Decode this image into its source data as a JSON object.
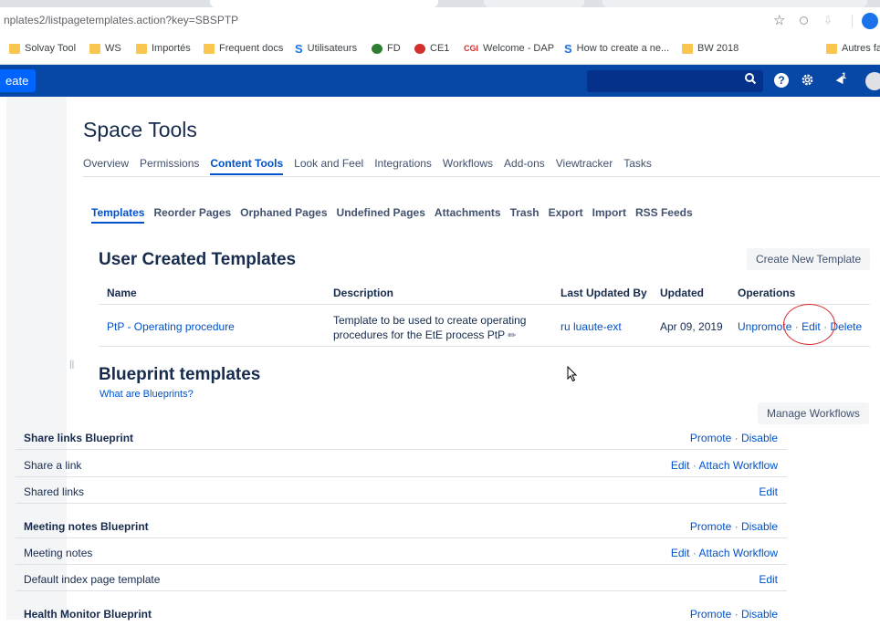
{
  "browser": {
    "url": "nplates2/listpagetemplates.action?key=SBSPTP",
    "bookmarks": [
      {
        "label": "Solvay Tool",
        "icon": "folder-icon"
      },
      {
        "label": "WS",
        "icon": "folder-icon"
      },
      {
        "label": "Importés",
        "icon": "folder-icon"
      },
      {
        "label": "Frequent docs",
        "icon": "folder-icon"
      },
      {
        "label": "Utilisateurs",
        "icon": "solvay-icon"
      },
      {
        "label": "FD",
        "icon": "green-circle-icon"
      },
      {
        "label": "CE1",
        "icon": "red-circle-icon"
      },
      {
        "label": "Welcome - DAP",
        "icon": "cgi-icon"
      },
      {
        "label": "How to create a ne...",
        "icon": "solvay-icon"
      },
      {
        "label": "BW 2018",
        "icon": "folder-icon"
      },
      {
        "label": "Autres fa",
        "icon": "folder-icon"
      }
    ]
  },
  "header": {
    "create_label": "eate",
    "notification_count": "1"
  },
  "page": {
    "title": "Space Tools",
    "tabs": [
      "Overview",
      "Permissions",
      "Content Tools",
      "Look and Feel",
      "Integrations",
      "Workflows",
      "Add-ons",
      "Viewtracker",
      "Tasks"
    ],
    "active_tab": "Content Tools",
    "subtabs": [
      "Templates",
      "Reorder Pages",
      "Orphaned Pages",
      "Undefined Pages",
      "Attachments",
      "Trash",
      "Export",
      "Import",
      "RSS Feeds"
    ],
    "active_subtab": "Templates"
  },
  "user_templates": {
    "heading": "User Created Templates",
    "create_button": "Create New Template",
    "columns": {
      "name": "Name",
      "description": "Description",
      "last_updated_by": "Last Updated By",
      "updated": "Updated",
      "operations": "Operations"
    },
    "rows": [
      {
        "name": "PtP - Operating procedure",
        "description_line1": "Template to be used to create operating",
        "description_line2": "procedures for the EtE process PtP",
        "last_updated_by": "ru luaute-ext",
        "updated": "Apr 09, 2019",
        "op_unpromote": "Unpromote",
        "op_edit": "Edit",
        "op_delete": "Delete",
        "separator": "·"
      }
    ]
  },
  "blueprints": {
    "heading": "Blueprint templates",
    "help_link": "What are Blueprints?",
    "manage_button": "Manage Workflows",
    "rows": [
      {
        "name": "Share links Blueprint",
        "bold": true,
        "a1": "Promote",
        "a2": "Disable"
      },
      {
        "name": "Share a link",
        "bold": false,
        "a1": "Edit",
        "a2": "Attach Workflow"
      },
      {
        "name": "Shared links",
        "bold": false,
        "a1": "Edit",
        "a2": ""
      },
      {
        "name": "Meeting notes Blueprint",
        "bold": true,
        "a1": "Promote",
        "a2": "Disable"
      },
      {
        "name": "Meeting notes",
        "bold": false,
        "a1": "Edit",
        "a2": "Attach Workflow"
      },
      {
        "name": "Default index page template",
        "bold": false,
        "a1": "Edit",
        "a2": ""
      },
      {
        "name": "Health Monitor Blueprint",
        "bold": true,
        "a1": "Promote",
        "a2": "Disable"
      }
    ]
  }
}
